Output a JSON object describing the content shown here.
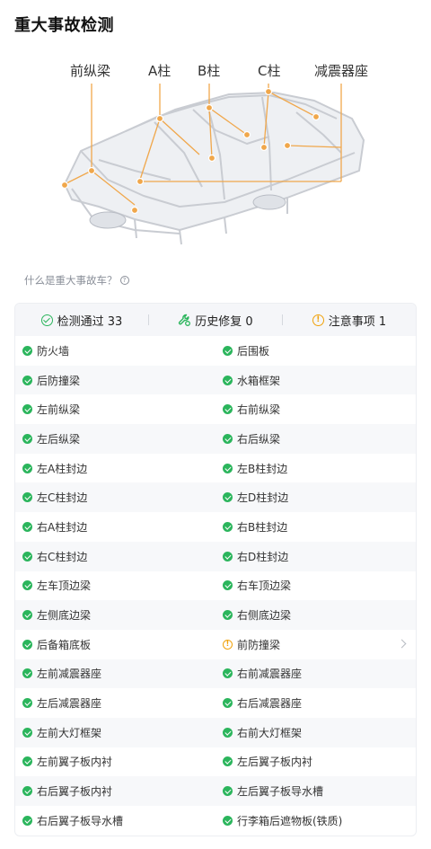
{
  "page_title": "重大事故检测",
  "diagram": {
    "labels": [
      "前纵梁",
      "A柱",
      "B柱",
      "C柱",
      "减震器座"
    ],
    "marker_color": "#f0a74b"
  },
  "help_link": "什么是重大事故车？",
  "summary": [
    {
      "icon": "check-circle-icon",
      "label": "检测通过 33",
      "color": "#2bb55c"
    },
    {
      "icon": "wrench-icon",
      "label": "历史修复 0",
      "color": "#2bb55c"
    },
    {
      "icon": "info-circle-icon",
      "label": "注意事项 1",
      "color": "#f0a20b"
    }
  ],
  "items": [
    [
      "防火墙",
      "后围板"
    ],
    [
      "后防撞梁",
      "水箱框架"
    ],
    [
      "左前纵梁",
      "右前纵梁"
    ],
    [
      "左后纵梁",
      "右后纵梁"
    ],
    [
      "左A柱封边",
      "左B柱封边"
    ],
    [
      "左C柱封边",
      "左D柱封边"
    ],
    [
      "右A柱封边",
      "右B柱封边"
    ],
    [
      "右C柱封边",
      "右D柱封边"
    ],
    [
      "左车顶边梁",
      "右车顶边梁"
    ],
    [
      "左侧底边梁",
      "右侧底边梁"
    ],
    [
      "后备箱底板",
      "前防撞梁"
    ],
    [
      "左前减震器座",
      "右前减震器座"
    ],
    [
      "左后减震器座",
      "右后减震器座"
    ],
    [
      "左前大灯框架",
      "右前大灯框架"
    ],
    [
      "左前翼子板内衬",
      "左后翼子板内衬"
    ],
    [
      "右后翼子板内衬",
      "左后翼子板导水槽"
    ],
    [
      "右后翼子板导水槽",
      "行李箱后遮物板(铁质)"
    ]
  ],
  "warn_item": "前防撞梁",
  "colors": {
    "pass": "#2bb55c",
    "warn": "#f0a20b"
  }
}
